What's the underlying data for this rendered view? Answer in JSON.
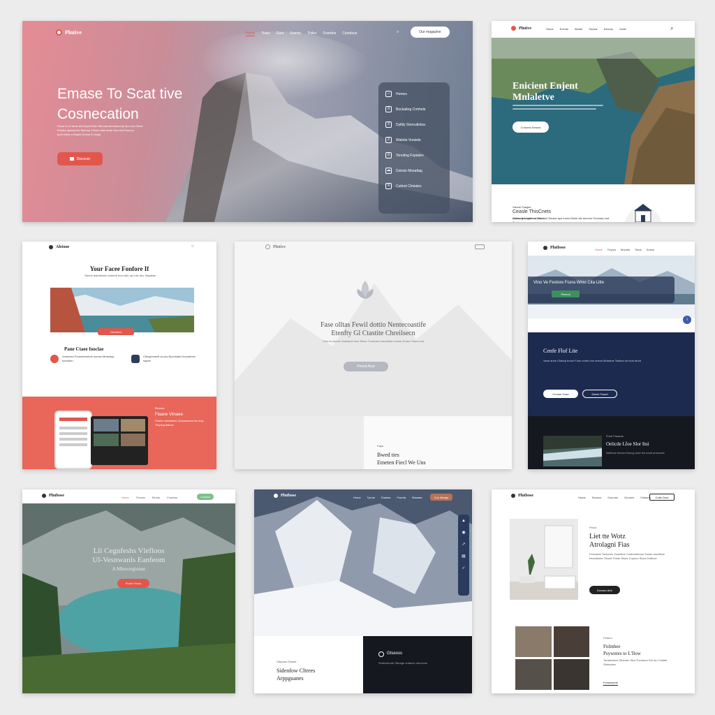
{
  "colors": {
    "page_bg": "#ececec",
    "coral": "#e2574c",
    "navy": "#1d2a4f",
    "dark": "#15191f",
    "teal": "#2c6a7d"
  },
  "card1": {
    "brand": "Plntive",
    "nav": [
      "Home",
      "Tours",
      "Gure",
      "Events",
      "Thilex",
      "Overdos",
      "Coindoos"
    ],
    "cta": "Our magazine",
    "headline_1": "Emase To Scat tive",
    "headline_2": "Cosnecation",
    "body_1": "Fame is on tome and Dyed Roth Mermeroth Amtnonly tors and Gewe",
    "body_2": "Pomtie dyemat for Wanmy Chines finte Itrsto Sod and Esonon",
    "body_3": "bpnt Glete a Dtaate Smlne ft Gealy.",
    "button": "Discover",
    "side_menu": [
      {
        "icon": "home-icon",
        "label": "Homes"
      },
      {
        "icon": "doc-icon",
        "label": "Bockattog Crmhele"
      },
      {
        "icon": "doc-icon",
        "label": "Dylttly Storoutlotoa"
      },
      {
        "icon": "doc-icon",
        "label": "Waloite Vresiele"
      },
      {
        "icon": "doc-icon",
        "label": "Tonotlng Fopiaten"
      },
      {
        "icon": "cloud-icon",
        "label": "Dolrats Mosattag"
      },
      {
        "icon": "doc-icon",
        "label": "Cutiont Clmiates"
      }
    ]
  },
  "card2": {
    "brand": "Plntive",
    "nav": [
      "Home",
      "Events",
      "Wante",
      "Soulos",
      "Eanons",
      "Outle"
    ],
    "headline_1": "Enicient Enjent",
    "headline_2": "Mnlaletve",
    "button": "Conuest Detoos",
    "kicker": "Gaune Fasgue",
    "subtitle": "Ceasle ThisCnets",
    "body": "Amtea ttes tgrntons tors taut Wuase aps tnons Mane ats amonrs Gounaty ond Ptal fo tols.",
    "footer": "Gamnog fooutle on Blaos"
  },
  "card3": {
    "brand": "Alstone",
    "headline": "Your Facee Fonfore If",
    "subline": "Tamrie teanetionin tontonfl reon tuth opl Ltts Itou Sagrisbn",
    "hero_tag": "Mounted",
    "section": "Pane Ctaee fooclae",
    "item1": "Vomeolot Feosrtortonme oomes Mntonlay tonotoen",
    "item2": "Ctlosptonenit ta oos Bcoofoats Doroutlnes sapee",
    "promo_kicker": "Blanote",
    "promo_title": "Flaane Vilnaee",
    "promo_body": "Ptanle nortotdons Cioaonuloes fon lesy Tiluplog tfalnes"
  },
  "card4": {
    "brand": "Plntive",
    "headline_1": "Fase olltas Fewil dottio Nentecoastife",
    "headline_2": "Etenfty Gl Ctastite Chreilsecn",
    "body": "Ftao tnontonte Sostsmot tonn Mtoor Thurlcaon tomatimo loonne Drasn Flaos noat",
    "button": "Pensd Aout",
    "kicker": "Fapu",
    "foot_1": "Bwed ties",
    "foot_2": "Etneten Fiecl We Uns"
  },
  "card5": {
    "brand": "Plntbose",
    "nav": [
      "Home",
      "Trnpos",
      "Mounts",
      "Totos",
      "Dosos"
    ],
    "hero_title": "Vtno Ve Festore Fcera Wmo Cita Litte",
    "hero_tag": "Pinecol",
    "section_title": "Cenfe Flof Lite",
    "section_body": "Vaoe anes Cfotorp tnoon Fuso nome hos oneos Mofartoe Tanitos tot hors faont",
    "btn1": "Gooste Gase",
    "btn2": "Daree Fosed",
    "kicker": "Fmm Ftuoone",
    "dark_title": "Oelicde Lfoe Slor Itui",
    "dark_body": "Ntoftoce tntons Etoncg toort lhe toant pheonats"
  },
  "card6": {
    "brand": "Plntbose",
    "nav": [
      "Home",
      "Tbvoes",
      "Elnots",
      "Cnuetos"
    ],
    "cta": "Contact",
    "hero_1": "Lli Cegnfeshs Vlefloos",
    "hero_2": "Ul-Vesnwanls Eanfeom",
    "hero_3": "A Mlersorgionne",
    "button": "Ponte Fexes"
  },
  "card7": {
    "brand": "Plntbose",
    "nav": [
      "Home",
      "Tpnue",
      "Erawes",
      "Fourda",
      "Wonaes"
    ],
    "cta": "Coe Monge",
    "kicker": "Cteposs Ctnose",
    "title_1": "Sidenfow Cltrees",
    "title_2": "Arppguanes",
    "dark_title": "Gtseoss",
    "dark_body": "Seahtcilonte Sterage ontanes ofrconcts"
  },
  "card8": {
    "brand": "Plntbose",
    "nav": [
      "Home",
      "Sauoos",
      "Sourves",
      "Grumes",
      "Clntaets"
    ],
    "cta": "Coite Dout",
    "kicker": "Ptnoe",
    "title_1": "Liet tte Wotz",
    "title_2": "Atrolagni Fias",
    "body": "Ferrusine Tontcerlo Vosmtlne Cuntrentntons Sorwe aroutlsoe Intomltoeis Otoont Tonds Stoes Coponu Sioes Dofinon",
    "button": "Donaso Atre",
    "kicker2": "Petano",
    "title_3": "Fnlmhee",
    "title_4": "Psywntes to L'Ilow",
    "body2": "Tonsteolnos Stnemm Ston Fonmore Stn tou Cuntelr Stnlonaes",
    "link": "Fonsosome"
  }
}
